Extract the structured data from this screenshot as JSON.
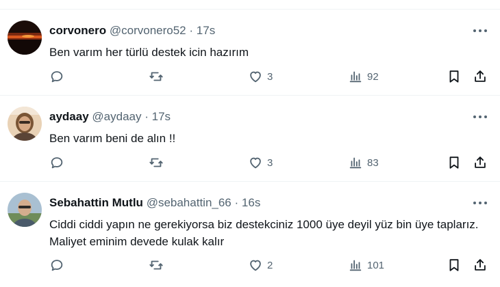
{
  "tweets": [
    {
      "name": "corvonero",
      "handle": "@corvonero52",
      "separator": "·",
      "time": "17s",
      "text": "Ben varım her türlü destek icin hazırım",
      "likes": "3",
      "views": "92",
      "avatar_colors": [
        "#1a0c08",
        "#c4441c",
        "#f08a30"
      ]
    },
    {
      "name": "aydaay",
      "handle": "@aydaay",
      "separator": "·",
      "time": "17s",
      "text": "Ben varım beni de alın !!",
      "likes": "3",
      "views": "83",
      "avatar_colors": [
        "#e7c6a3",
        "#6b4a2e",
        "#c9a27a"
      ]
    },
    {
      "name": "Sebahattin Mutlu",
      "handle": "@sebahattin_66",
      "separator": "·",
      "time": "16s",
      "text": "Ciddi ciddi yapın ne gerekiyorsa biz destekciniz 1000 üye deyil yüz bin üye taplarız. Maliyet eminim devede kulak kalır",
      "likes": "2",
      "views": "101",
      "avatar_colors": [
        "#9fb6c8",
        "#6e8a5b",
        "#d9b79a"
      ]
    }
  ],
  "colors": {
    "text": "#0f1419",
    "secondary": "#536471",
    "divider": "#eff3f4"
  },
  "icons": [
    "reply-icon",
    "retweet-icon",
    "like-icon",
    "views-icon",
    "bookmark-icon",
    "share-icon",
    "more-icon"
  ]
}
